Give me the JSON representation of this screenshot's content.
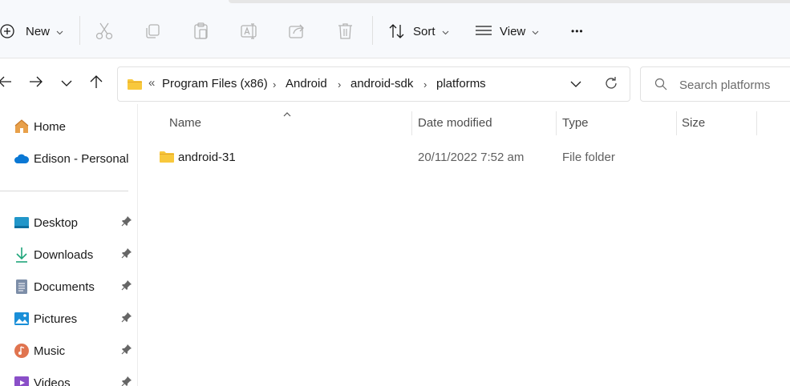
{
  "toolbar": {
    "new_label": "New",
    "sort_label": "Sort",
    "view_label": "View",
    "more_label": "•••"
  },
  "address": {
    "overflow": "«",
    "segments": [
      "Program Files (x86)",
      "Android",
      "android-sdk",
      "platforms"
    ],
    "separator": "›"
  },
  "search": {
    "placeholder": "Search platforms"
  },
  "sidebar": {
    "items": [
      {
        "label": "Home",
        "icon": "home-icon"
      },
      {
        "label": "Edison - Personal",
        "icon": "onedrive-cloud-icon"
      },
      {
        "label": "Desktop",
        "icon": "desktop-icon"
      },
      {
        "label": "Downloads",
        "icon": "download-arrow-icon"
      },
      {
        "label": "Documents",
        "icon": "document-icon"
      },
      {
        "label": "Pictures",
        "icon": "pictures-icon"
      },
      {
        "label": "Music",
        "icon": "music-icon"
      },
      {
        "label": "Videos",
        "icon": "videos-icon"
      }
    ]
  },
  "columns": {
    "name": "Name",
    "date": "Date modified",
    "type": "Type",
    "size": "Size"
  },
  "files": [
    {
      "name": "android-31",
      "date": "20/11/2022 7:52 am",
      "type": "File folder",
      "size": ""
    }
  ],
  "colors": {
    "accent": "#0067c0",
    "folder": "#f8c83c",
    "folder_dark": "#e5a82a"
  }
}
